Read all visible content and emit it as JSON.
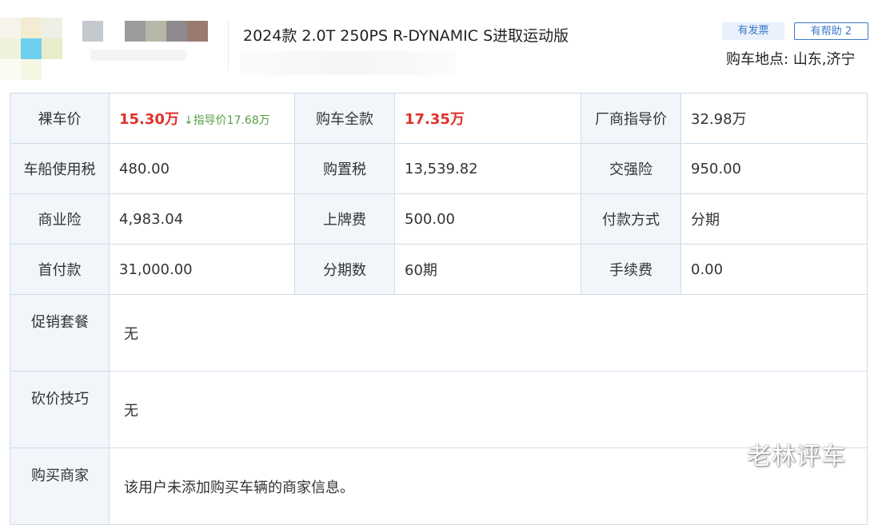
{
  "header": {
    "car_title": "2024款 2.0T 250PS R-DYNAMIC S进取运动版",
    "invoice_tag": "有发票",
    "helpful_button": "有帮助 2",
    "location_label": "购车地点:",
    "location_value": "山东,济宁"
  },
  "price_table": {
    "row1": {
      "bare_price_label": "裸车价",
      "bare_price_value": "15.30万",
      "guide_note": "↓指导价17.68万",
      "full_price_label": "购车全款",
      "full_price_value": "17.35万",
      "msrp_label": "厂商指导价",
      "msrp_value": "32.98万"
    },
    "row2": {
      "vehicle_tax_label": "车船使用税",
      "vehicle_tax_value": "480.00",
      "purchase_tax_label": "购置税",
      "purchase_tax_value": "13,539.82",
      "compulsory_ins_label": "交强险",
      "compulsory_ins_value": "950.00"
    },
    "row3": {
      "commercial_ins_label": "商业险",
      "commercial_ins_value": "4,983.04",
      "plate_fee_label": "上牌费",
      "plate_fee_value": "500.00",
      "payment_label": "付款方式",
      "payment_value": "分期"
    },
    "row4": {
      "down_payment_label": "首付款",
      "down_payment_value": "31,000.00",
      "installments_label": "分期数",
      "installments_value": "60期",
      "fee_label": "手续费",
      "fee_value": "0.00"
    },
    "promotion_label": "促销套餐",
    "promotion_value": "无",
    "bargain_label": "砍价技巧",
    "bargain_value": "无",
    "dealer_label": "购买商家",
    "dealer_value": "该用户未添加购买车辆的商家信息。"
  },
  "watermark": "老林评车",
  "colors": {
    "price_red": "#e0322d",
    "guide_green": "#58a046",
    "accent_blue": "#3a77c9",
    "border": "#cfdcea",
    "label_bg": "#f2f5f9"
  }
}
